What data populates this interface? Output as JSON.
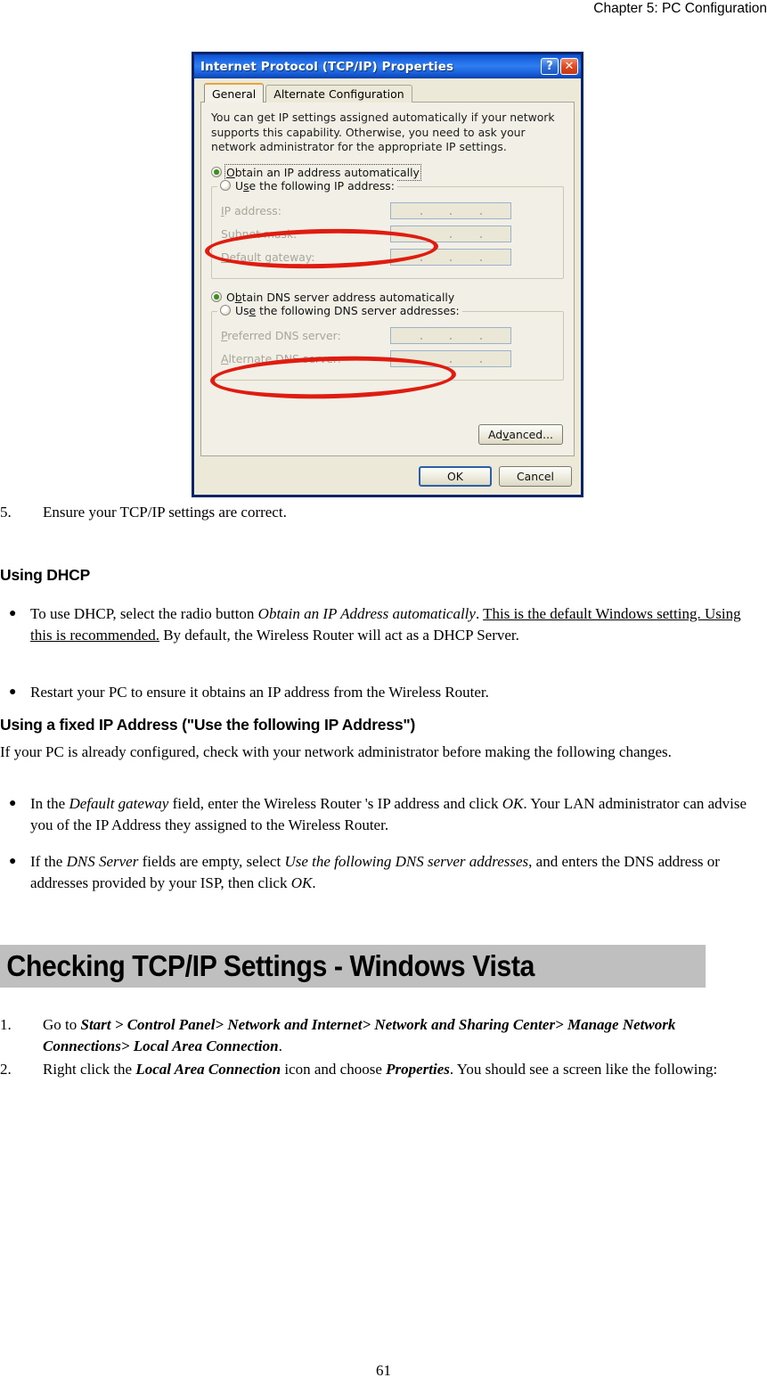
{
  "page": {
    "header": "Chapter 5: PC Configuration",
    "number": "61"
  },
  "dialog": {
    "title": "Internet Protocol (TCP/IP) Properties",
    "titlebar_buttons": {
      "help": "?",
      "close": "✕"
    },
    "tabs": [
      {
        "label": "General",
        "active": true
      },
      {
        "label": "Alternate Configuration",
        "active": false
      }
    ],
    "intro": "You can get IP settings assigned automatically if your network supports this capability. Otherwise, you need to ask your network administrator for the appropriate IP settings.",
    "radio_ip_auto": {
      "label": "Obtain an IP address automatically",
      "selected": true
    },
    "group_ip": {
      "legend": "Use the following IP address:",
      "radio_selected": false,
      "fields": [
        {
          "label": "IP address:",
          "value": ""
        },
        {
          "label": "Subnet mask:",
          "value": ""
        },
        {
          "label": "Default gateway:",
          "value": ""
        }
      ]
    },
    "radio_dns_auto": {
      "label": "Obtain DNS server address automatically",
      "selected": true
    },
    "group_dns": {
      "legend": "Use the following DNS server addresses:",
      "radio_selected": false,
      "fields": [
        {
          "label": "Preferred DNS server:",
          "value": ""
        },
        {
          "label": "Alternate DNS server:",
          "value": ""
        }
      ]
    },
    "advanced_button": "Advanced...",
    "ok_button": "OK",
    "cancel_button": "Cancel",
    "annotations": [
      {
        "name": "red-ellipse-obtain-ip",
        "color": "#e01b10"
      },
      {
        "name": "red-ellipse-obtain-dns",
        "color": "#e01b10"
      }
    ]
  },
  "content": {
    "step5": {
      "num": "5.",
      "text": "Ensure your TCP/IP settings are correct."
    },
    "heading_dhcp": "Using DHCP",
    "bullet_dhcp_1": {
      "p1": "To use DHCP, select the radio button ",
      "i1": "Obtain an IP Address automatically",
      "p2": ". ",
      "u1": "This is the default Windows setting. Using this is recommended.",
      "p3": " By default, the Wireless Router will act as a DHCP Server."
    },
    "bullet_dhcp_2": "Restart your PC to ensure it obtains an IP address from the Wireless Router.",
    "heading_fixed": "Using a fixed IP Address (\"Use the following IP Address\")",
    "para_fixed": "If your PC is already configured, check with your network administrator before making the following changes.",
    "bullet_fixed_1": {
      "p1": "In the ",
      "i1": "Default gateway",
      "p2": " field, enter the Wireless Router 's IP address and click ",
      "i2": "OK",
      "p3": ". Your LAN administrator can advise you of the IP Address they assigned to the Wireless Router."
    },
    "bullet_fixed_2": {
      "p1": "If the ",
      "i1": "DNS Server",
      "p2": " fields are empty, select ",
      "i2": "Use the following DNS server addresses",
      "p3": ", and enters the DNS address or addresses provided by your ISP, then click ",
      "i3": "OK",
      "p4": "."
    },
    "banner_vista": "Checking TCP/IP Settings - Windows Vista",
    "step1": {
      "num": "1.",
      "p1": "Go to ",
      "bi1": "Start > Control Panel> Network and Internet>  Network and Sharing Center> Manage Network Connections> Local Area Connection",
      "p2": "."
    },
    "step2": {
      "num": "2.",
      "p1": "Right click the ",
      "bi1": "Local Area Connection",
      "p2": " icon and choose ",
      "bi2": "Properties",
      "p3": ". You should see a screen like the following:"
    }
  }
}
